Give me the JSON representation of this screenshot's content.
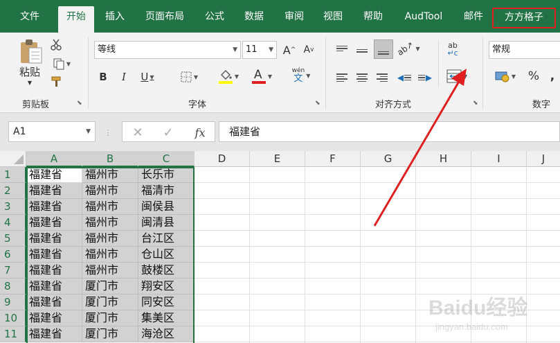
{
  "tabs": [
    "文件",
    "开始",
    "插入",
    "页面布局",
    "公式",
    "数据",
    "审阅",
    "视图",
    "帮助",
    "AudTool",
    "邮件",
    "方方格子"
  ],
  "active_tab": "开始",
  "highlighted_tab": "方方格子",
  "ribbon": {
    "clipboard": {
      "paste_label": "粘贴",
      "group_label": "剪贴板"
    },
    "font": {
      "font_name": "等线",
      "font_size": "11",
      "grow_label": "A",
      "shrink_label": "A",
      "bold": "B",
      "italic": "I",
      "underline": "U",
      "font_color_label": "A",
      "phonetic_top": "wén",
      "phonetic_bottom": "文",
      "group_label": "字体"
    },
    "alignment": {
      "group_label": "对齐方式",
      "wrap_top": "ab",
      "wrap_bottom": "c"
    },
    "number": {
      "format": "常规",
      "percent": "%",
      "comma": ",",
      "group_label": "数字"
    }
  },
  "formula_bar": {
    "name_box": "A1",
    "fx": "fx",
    "formula": "福建省"
  },
  "columns": [
    "A",
    "B",
    "C",
    "D",
    "E",
    "F",
    "G",
    "H",
    "I",
    "J"
  ],
  "rows": [
    {
      "num": "1",
      "a": "福建省",
      "b": "福州市",
      "c": "长乐市"
    },
    {
      "num": "2",
      "a": "福建省",
      "b": "福州市",
      "c": "福清市"
    },
    {
      "num": "3",
      "a": "福建省",
      "b": "福州市",
      "c": "闽侯县"
    },
    {
      "num": "4",
      "a": "福建省",
      "b": "福州市",
      "c": "闽清县"
    },
    {
      "num": "5",
      "a": "福建省",
      "b": "福州市",
      "c": "台江区"
    },
    {
      "num": "6",
      "a": "福建省",
      "b": "福州市",
      "c": "仓山区"
    },
    {
      "num": "7",
      "a": "福建省",
      "b": "福州市",
      "c": "鼓楼区"
    },
    {
      "num": "8",
      "a": "福建省",
      "b": "厦门市",
      "c": "翔安区"
    },
    {
      "num": "9",
      "a": "福建省",
      "b": "厦门市",
      "c": "同安区"
    },
    {
      "num": "10",
      "a": "福建省",
      "b": "厦门市",
      "c": "集美区"
    },
    {
      "num": "11",
      "a": "福建省",
      "b": "厦门市",
      "c": "海沧区"
    }
  ],
  "selected_columns": [
    "A",
    "B",
    "C"
  ],
  "watermark": "Baidu经验 jingyan.baidu.com",
  "colors": {
    "excel_green": "#217346",
    "selection_gray": "#d2d2d2",
    "annotation_red": "#e02020"
  }
}
